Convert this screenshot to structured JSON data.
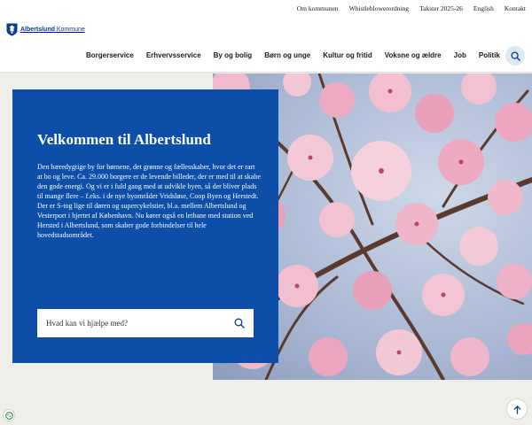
{
  "top_links": [
    "Om kommunen",
    "Whistleblowerordning",
    "Takster 2025-26",
    "English",
    "Kontakt"
  ],
  "logo": {
    "name_bold": "Albertslund",
    "name_rest": "Kommune"
  },
  "nav": [
    "Borgerservice",
    "Erhvervsservice",
    "By og bolig",
    "Børn og unge",
    "Kultur og fritid",
    "Voksne og ældre",
    "Job",
    "Politik"
  ],
  "hero": {
    "title": "Velkommen til Albertslund",
    "body": "Den bæredygtige by for børnene, det grønne og fællesskaber, hvor det er rart at bo og leve. Ca. 29.000 borgere er de levende billeder, der er med til at skabe den gode energi. Og vi er i fuld gang med at udvikle byen, så der bliver plads til mange flere – f.eks. i de nye byområder Vridsløse, Coop Byen og Herstedt. Der er S-tog lige til døren og supercykelstier, bl.a. mellem Albertslund og Vesterport i hjertet af København. Nu kører også en letbane med station ved Hersted i Albertslund, som skaber gode forbindelser til hele hovedstadsområdet.",
    "search_placeholder": "Hvad kan vi hjælpe med?"
  },
  "colors": {
    "panel": "#0d4ea8",
    "brand": "#0a3d8f"
  },
  "icons": {
    "search": "search-icon",
    "cookie": "cookie-icon",
    "arrow": "arrow-up-icon",
    "logo": "crest-icon"
  }
}
